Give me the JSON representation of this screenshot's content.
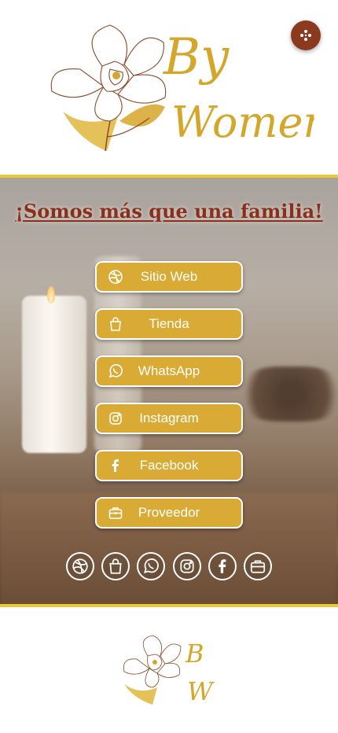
{
  "brand": {
    "by": "By",
    "women": "Women",
    "initial_b": "B",
    "initial_w": "W"
  },
  "menu": {
    "icon": "dots-grid-icon",
    "accent": "#8b3a1d"
  },
  "hero": {
    "title": "¡Somos más que una familia!"
  },
  "buttons": [
    {
      "label": "Sitio Web",
      "icon": "dribbble-icon"
    },
    {
      "label": "Tienda",
      "icon": "shopping-bag-icon"
    },
    {
      "label": "WhatsApp",
      "icon": "whatsapp-icon"
    },
    {
      "label": "Instagram",
      "icon": "instagram-icon"
    },
    {
      "label": "Facebook",
      "icon": "facebook-icon"
    },
    {
      "label": "Proveedor",
      "icon": "briefcase-icon"
    }
  ],
  "socials": [
    "dribbble-icon",
    "shopping-bag-icon",
    "whatsapp-icon",
    "instagram-icon",
    "facebook-icon",
    "briefcase-icon"
  ],
  "colors": {
    "button_bg": "#d9ab35",
    "border_gold": "#e8c93e",
    "title_red": "#8b2f1a",
    "logo_gold": "#d4a62a"
  }
}
